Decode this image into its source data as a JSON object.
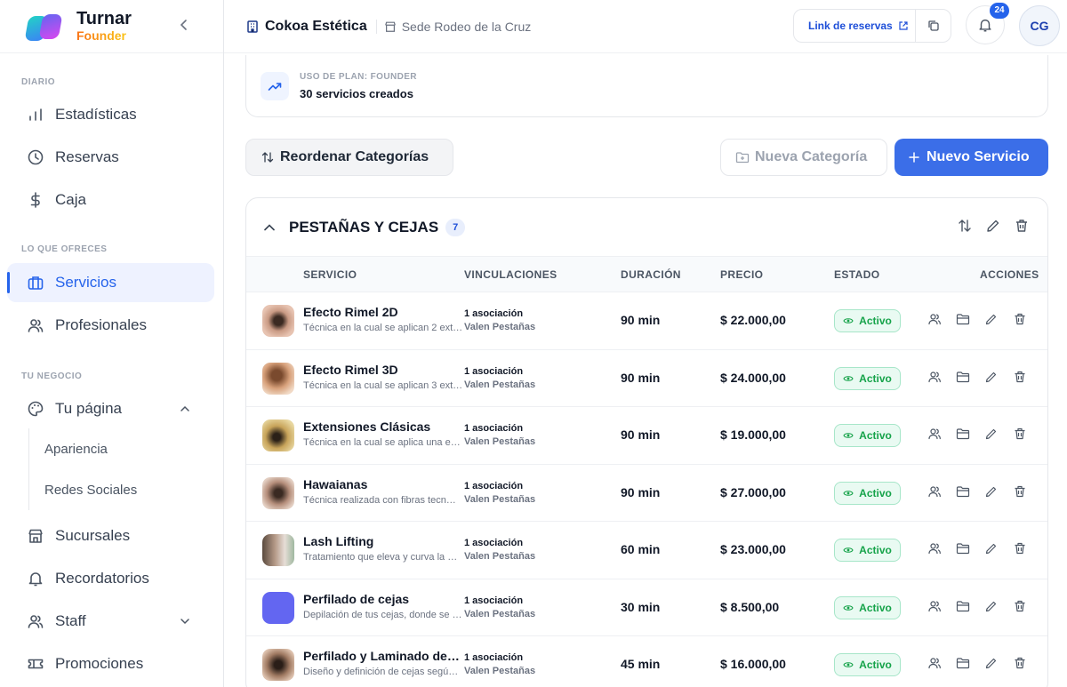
{
  "brand": {
    "name": "Turnar",
    "plan": "Founder"
  },
  "sidebar": {
    "sections": [
      {
        "label": "DIARIO"
      },
      {
        "label": "LO QUE OFRECES"
      },
      {
        "label": "TU NEGOCIO"
      }
    ],
    "items": {
      "estadisticas": "Estadísticas",
      "reservas": "Reservas",
      "caja": "Caja",
      "servicios": "Servicios",
      "profesionales": "Profesionales",
      "tu_pagina": "Tu página",
      "apariencia": "Apariencia",
      "redes": "Redes Sociales",
      "sucursales": "Sucursales",
      "recordatorios": "Recordatorios",
      "staff": "Staff",
      "promociones": "Promociones"
    }
  },
  "header": {
    "business": "Cokoa Estética",
    "branch": "Sede Rodeo de la Cruz",
    "link_label": "Link de reservas",
    "notifications": "24",
    "avatar": "CG"
  },
  "plan": {
    "label": "USO DE PLAN: FOUNDER",
    "usage": "30 servicios creados"
  },
  "toolbar": {
    "reorder": "Reordenar Categorías",
    "new_category": "Nueva Categoría",
    "new_service": "Nuevo Servicio"
  },
  "category": {
    "title": "PESTAÑAS Y CEJAS",
    "count": "7",
    "columns": [
      "SERVICIO",
      "VINCULACIONES",
      "DURACIÓN",
      "PRECIO",
      "ESTADO",
      "ACCIONES"
    ],
    "rows": [
      {
        "name": "Efecto Rimel 2D",
        "desc": "Técnica en la cual se aplican 2 ext…",
        "assoc": "1 asociación",
        "pro": "Valen Pestañas",
        "duration": "90 min",
        "price": "$ 22.000,00",
        "status": "Activo"
      },
      {
        "name": "Efecto Rimel 3D",
        "desc": "Técnica en la cual se aplican 3 ext…",
        "assoc": "1 asociación",
        "pro": "Valen Pestañas",
        "duration": "90 min",
        "price": "$ 24.000,00",
        "status": "Activo"
      },
      {
        "name": "Extensiones Clásicas",
        "desc": "Técnica en la cual se aplica una e…",
        "assoc": "1 asociación",
        "pro": "Valen Pestañas",
        "duration": "90 min",
        "price": "$ 19.000,00",
        "status": "Activo"
      },
      {
        "name": "Hawaianas",
        "desc": "Técnica realizada con fibras tecn…",
        "assoc": "1 asociación",
        "pro": "Valen Pestañas",
        "duration": "90 min",
        "price": "$ 27.000,00",
        "status": "Activo"
      },
      {
        "name": "Lash Lifting",
        "desc": "Tratamiento que eleva y curva la …",
        "assoc": "1 asociación",
        "pro": "Valen Pestañas",
        "duration": "60 min",
        "price": "$ 23.000,00",
        "status": "Activo"
      },
      {
        "name": "Perfilado de cejas",
        "desc": "Depilación de tus cejas, donde se …",
        "assoc": "1 asociación",
        "pro": "Valen Pestañas",
        "duration": "30 min",
        "price": "$ 8.500,00",
        "status": "Activo"
      },
      {
        "name": "Perfilado y Laminado de C…",
        "desc": "Diseño y definición de cejas segú…",
        "assoc": "1 asociación",
        "pro": "Valen Pestañas",
        "duration": "45 min",
        "price": "$ 16.000,00",
        "status": "Activo"
      }
    ]
  },
  "colors": {
    "accent": "#3b6ee8",
    "active_bg": "#eef2ff",
    "status_green": "#16a34a",
    "thumb_purple": "#6366f1"
  }
}
